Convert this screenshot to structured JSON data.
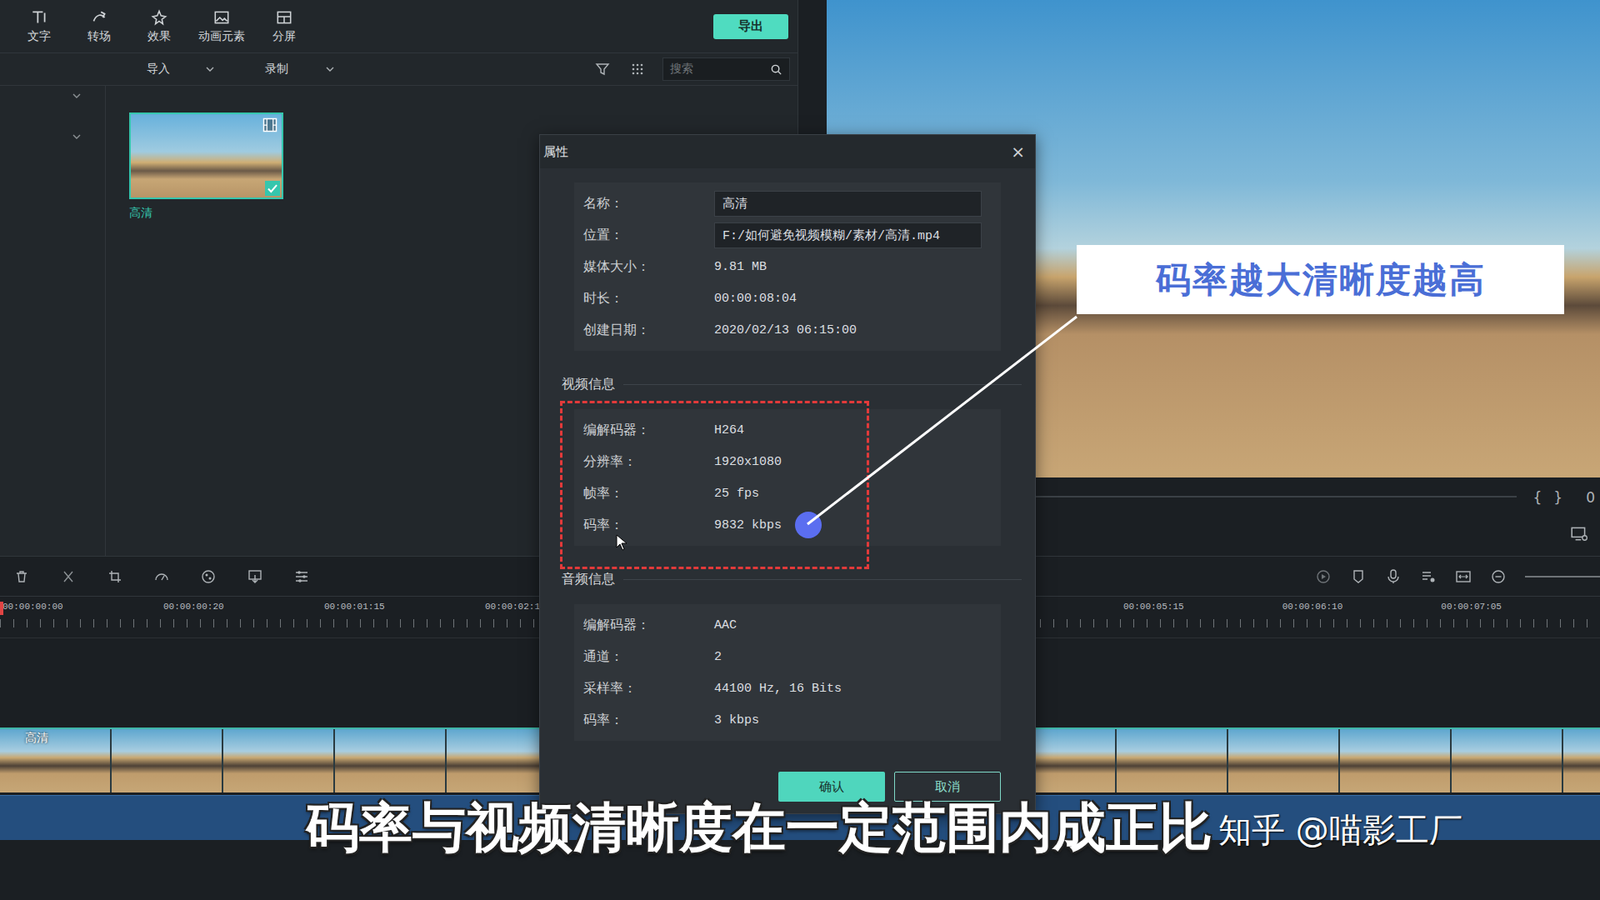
{
  "toolbar": {
    "tools": [
      "文字",
      "转场",
      "效果",
      "动画元素",
      "分屏"
    ],
    "export": "导出"
  },
  "media_bar": {
    "import": "导入",
    "record": "录制",
    "search_placeholder": "搜索"
  },
  "media": [
    {
      "name": "高清",
      "selected": true
    }
  ],
  "preview": {
    "brackets": [
      "{",
      "}"
    ],
    "timecode": "0"
  },
  "timeline": {
    "ruler_left": [
      "00:00:00:00",
      "00:00:00:20",
      "00:00:01:15",
      "00:00:02:1"
    ],
    "ruler_right": [
      "00:00:05:15",
      "00:00:06:10",
      "00:00:07:05"
    ],
    "tracks": [
      {
        "name": "高清"
      }
    ]
  },
  "dialog": {
    "title": "属性",
    "close": "×",
    "general": [
      {
        "label": "名称：",
        "value": "高清",
        "kind": "input"
      },
      {
        "label": "位置：",
        "value": "F:/如何避免视频模糊/素材/高清.mp4",
        "kind": "input"
      },
      {
        "label": "媒体大小：",
        "value": "9.81 MB",
        "kind": "text"
      },
      {
        "label": "时长：",
        "value": "00:00:08:04",
        "kind": "text"
      },
      {
        "label": "创建日期：",
        "value": "2020/02/13 06:15:00",
        "kind": "text"
      }
    ],
    "sections": [
      {
        "title": "视频信息",
        "highlighted": true,
        "rows": [
          {
            "label": "编解码器：",
            "value": "H264"
          },
          {
            "label": "分辨率：",
            "value": "1920x1080"
          },
          {
            "label": "帧率：",
            "value": "25 fps"
          },
          {
            "label": "码率：",
            "value": "9832 kbps"
          }
        ]
      },
      {
        "title": "音频信息",
        "highlighted": false,
        "rows": [
          {
            "label": "编解码器：",
            "value": "AAC"
          },
          {
            "label": "通道：",
            "value": "2"
          },
          {
            "label": "采样率：",
            "value": "44100 Hz, 16 Bits"
          },
          {
            "label": "码率：",
            "value": "3 kbps"
          }
        ]
      }
    ],
    "buttons": [
      {
        "label": "确认",
        "primary": true
      },
      {
        "label": "取消",
        "primary": false
      }
    ]
  },
  "annotation": "码率越大清晰度越高",
  "subtitle": "码率与视频清晰度在一定范围内成正比",
  "watermark": "知乎 @喵影工厂"
}
